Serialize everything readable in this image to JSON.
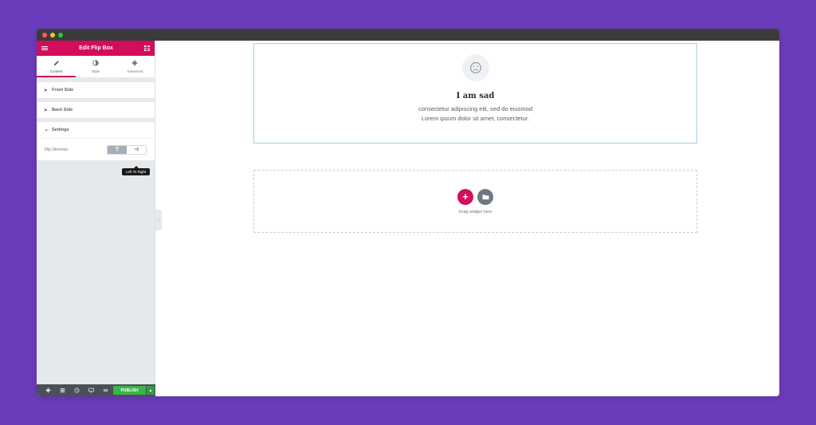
{
  "window": {
    "controls": [
      "close",
      "minimize",
      "maximize"
    ],
    "colors": {
      "close": "#ff5f57",
      "minimize": "#febc2e",
      "maximize": "#28c840"
    }
  },
  "sidebar": {
    "header": {
      "title": "Edit Flip Box",
      "menu_icon": "hamburger-icon",
      "apps_icon": "grid-icon",
      "color": "#d30c5c"
    },
    "tabs": [
      {
        "label": "Content",
        "icon": "pencil-icon",
        "active": true
      },
      {
        "label": "Style",
        "icon": "contrast-icon",
        "active": false
      },
      {
        "label": "Advanced",
        "icon": "gear-icon",
        "active": false
      }
    ],
    "sections": [
      {
        "label": "Front Side",
        "expanded": false
      },
      {
        "label": "Back Side",
        "expanded": false
      },
      {
        "label": "Settings",
        "expanded": true
      }
    ],
    "settings": {
      "flip_direction_label": "Flip Direction",
      "choices": [
        {
          "icon": "arrow-down-icon",
          "selected": true
        },
        {
          "icon": "arrow-right-icon",
          "selected": false
        }
      ],
      "tooltip": "Left To Right"
    },
    "footer": {
      "icons": [
        "settings-icon",
        "navigator-icon",
        "history-icon",
        "responsive-icon",
        "preview-icon"
      ],
      "publish_label": "PUBLISH",
      "publish_color": "#39b54a"
    }
  },
  "canvas": {
    "flipbox": {
      "icon": "sad-face-icon",
      "title": "I am sad",
      "text": "consectetur adipiscing elit, sed do eiusmod Lorem ipsum dolor sit amet, consectetur."
    },
    "dropzone": {
      "text": "Drag widget here"
    }
  }
}
